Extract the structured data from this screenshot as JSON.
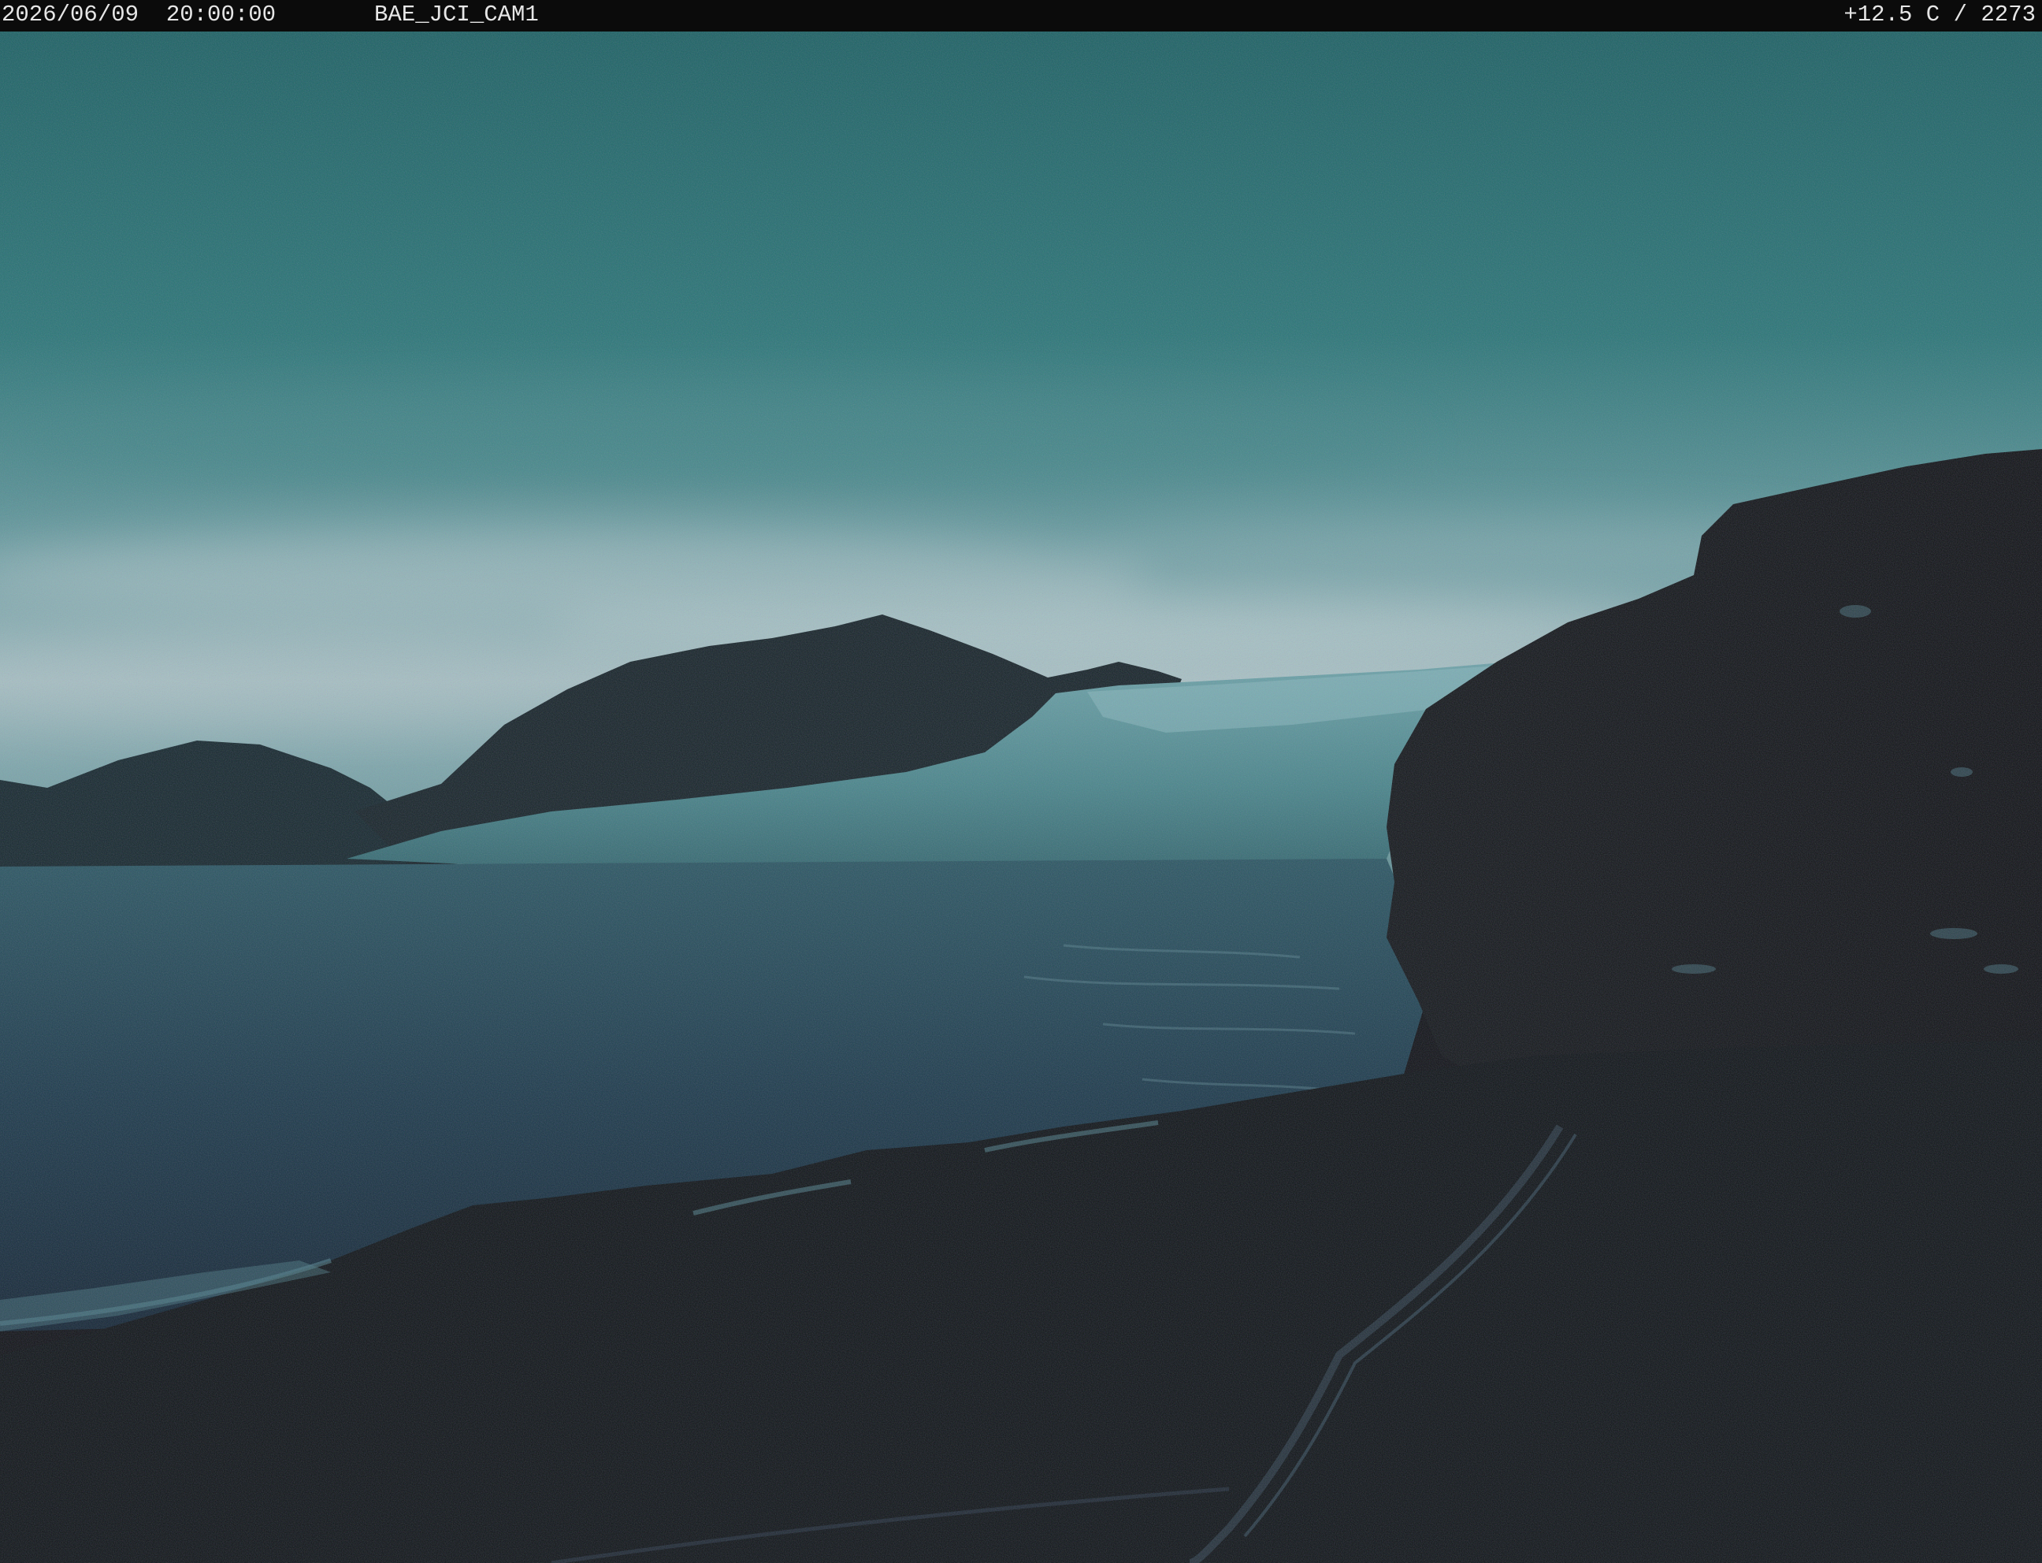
{
  "overlay": {
    "datetime": "2026/06/09  20:00:00",
    "camera_id": "BAE_JCI_CAM1",
    "readout": "+12.5 C / 2273"
  },
  "colors": {
    "header_background": "#0b0b0b",
    "header_text": "#e6e6e6",
    "sky_top": "#1f6b6c",
    "sky_horizon": "#a9c6c8",
    "glacier": "#4f8e92",
    "water": "#1c3b4c",
    "rock_dark": "#111315"
  }
}
